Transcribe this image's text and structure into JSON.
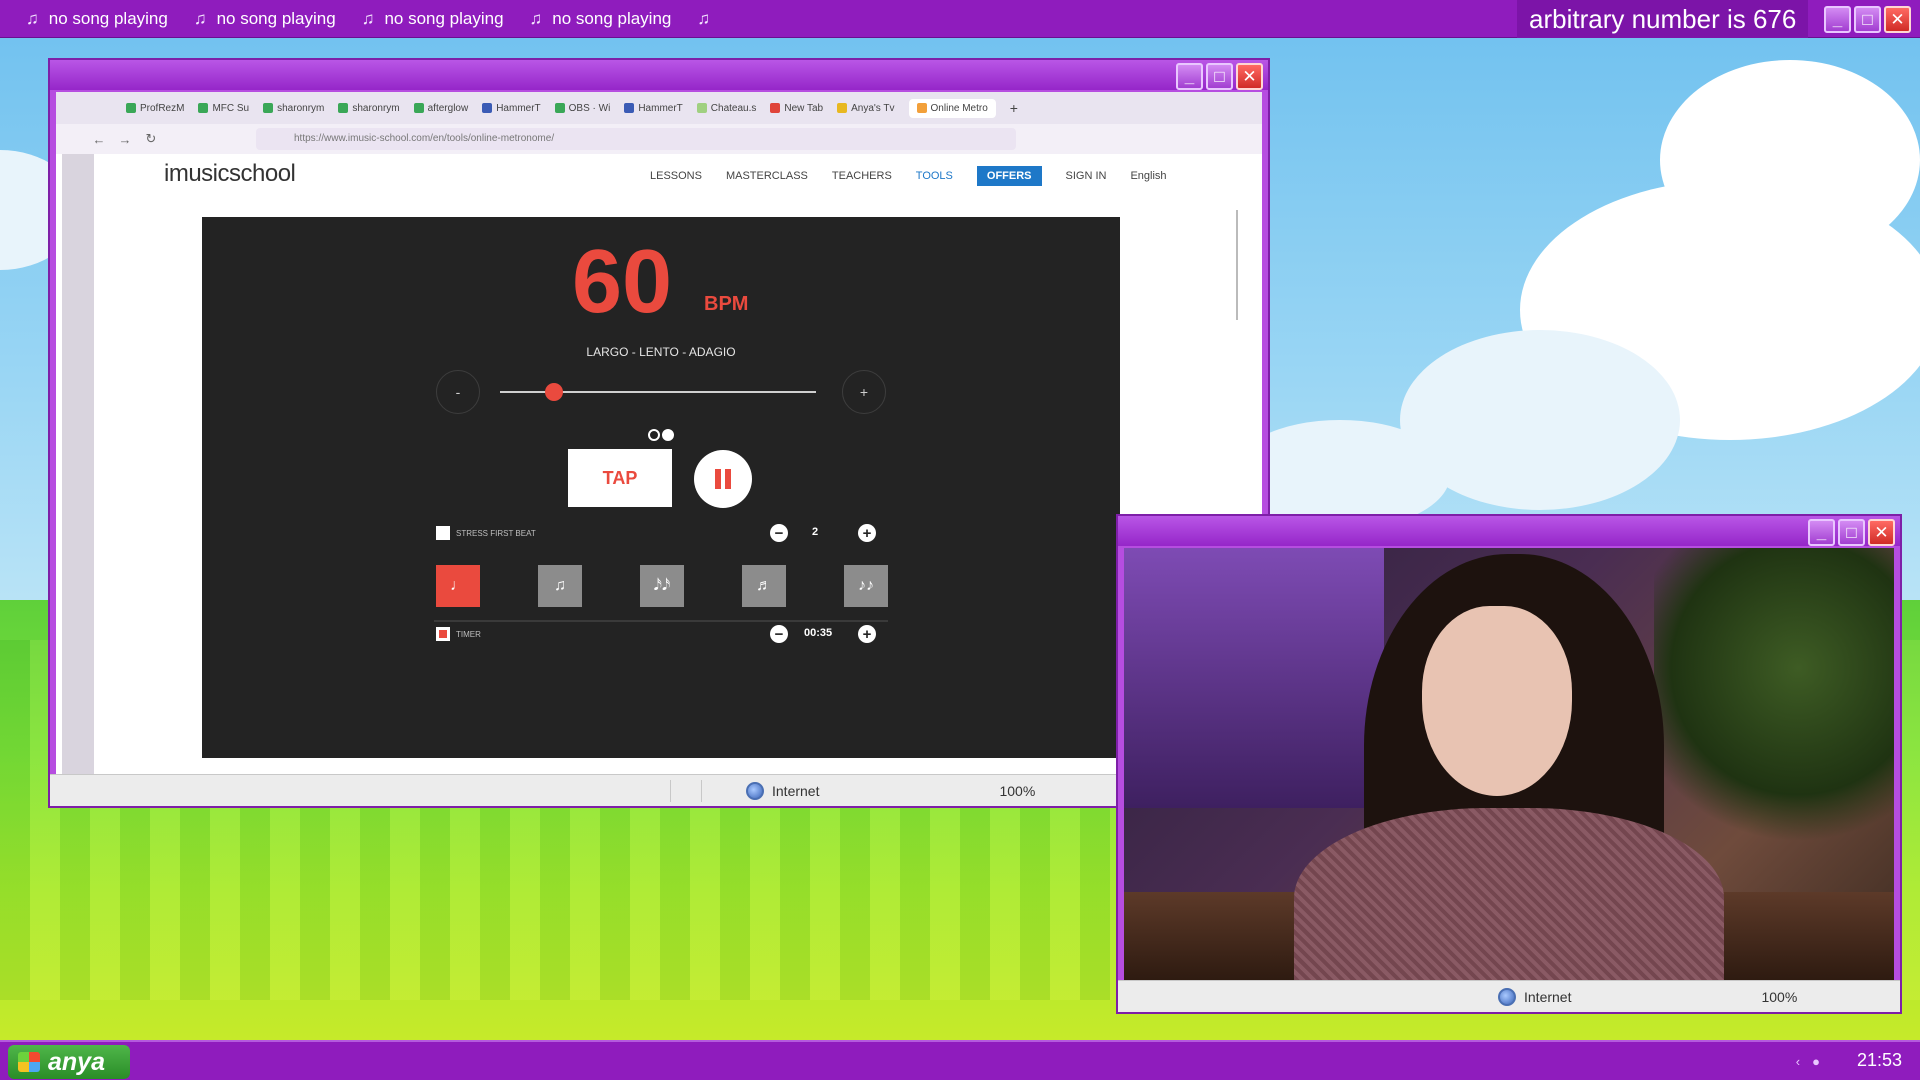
{
  "topbar": {
    "now_playing": [
      "no song playing",
      "no song playing",
      "no song playing",
      "no song playing",
      ""
    ],
    "arbitrary": "arbitrary number is 676"
  },
  "browser": {
    "tabs": [
      "ProfRezM",
      "MFC Su",
      "sharonrym",
      "sharonrym",
      "afterglow",
      "HammerT",
      "OBS · Wi",
      "HammerT",
      "Chateau.s",
      "New Tab",
      "Anya's Tv",
      "Online Metro"
    ],
    "url": "https://www.imusic-school.com/en/tools/online-metronome/",
    "site": {
      "logo": "imusicschool",
      "nav": {
        "lessons": "LESSONS",
        "masterclass": "MASTERCLASS",
        "teachers": "TEACHERS",
        "tools": "TOOLS",
        "offers": "OFFERS",
        "signin": "SIGN IN",
        "language": "English"
      }
    },
    "status": {
      "zone": "Internet",
      "zoom": "100%"
    }
  },
  "metronome": {
    "bpm": "60",
    "bpm_unit": "BPM",
    "tempo_name": "LARGO - LENTO - ADAGIO",
    "minus": "-",
    "plus": "+",
    "slider_fraction": 0.17,
    "tap": "TAP",
    "stress_label": "STRESS FIRST BEAT",
    "beats_value": "2",
    "timer_label": "TIMER",
    "timer_value": "00:35",
    "subdivisions": [
      "♩",
      "♫",
      "𝅘𝅥𝅯𝅘𝅥𝅯",
      "♬",
      "♪♪"
    ],
    "active_subdivision": 0
  },
  "webcam": {
    "status": {
      "zone": "Internet",
      "zoom": "100%"
    }
  },
  "taskbar": {
    "start_label": "anya",
    "clock": "21:53"
  },
  "colors": {
    "accent_red": "#ea4a3e",
    "purple": "#8f1cbd",
    "offers_blue": "#1e78c8"
  }
}
